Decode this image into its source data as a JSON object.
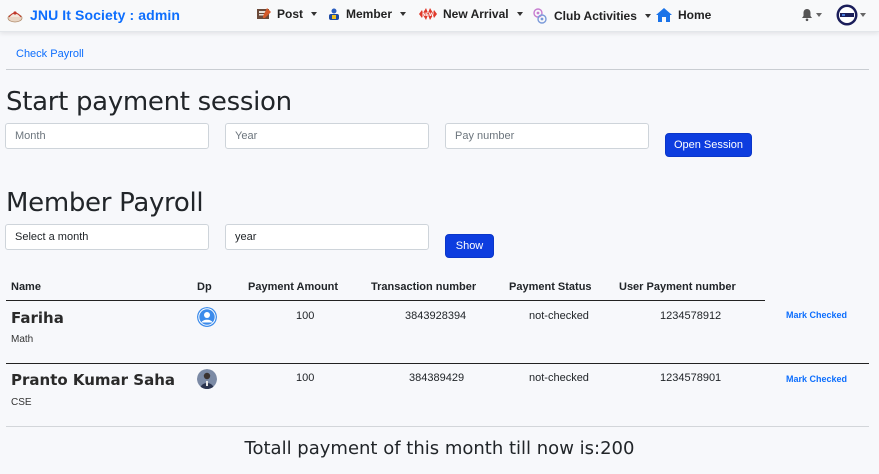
{
  "app": {
    "brand": "JNU It Society : admin"
  },
  "nav": {
    "post": "Post",
    "member": "Member",
    "new_arrival": "New Arrival",
    "club_activities": "Club Activities",
    "home": "Home"
  },
  "breadcrumb": "Check Payroll",
  "session": {
    "title": "Start payment session",
    "month_placeholder": "Month",
    "year_placeholder": "Year",
    "pay_number_placeholder": "Pay number",
    "open_button": "Open Session"
  },
  "payroll": {
    "title": "Member Payroll",
    "month_select": "Select a month",
    "year_value": "year",
    "show_button": "Show"
  },
  "table": {
    "headers": [
      "Name",
      "Dp",
      "Payment Amount",
      "Transaction number",
      "Payment Status",
      "User Payment number"
    ],
    "rows": [
      {
        "name": "Fariha",
        "dept": "Math",
        "amount": "100",
        "transaction": "3843928394",
        "status": "not-checked",
        "user_number": "1234578912",
        "action": "Mark Checked"
      },
      {
        "name": "Pranto Kumar Saha",
        "dept": "CSE",
        "amount": "100",
        "transaction": "384389429",
        "status": "not-checked",
        "user_number": "1234578901",
        "action": "Mark Checked"
      }
    ]
  },
  "total": "Totall payment of this month till now is:200",
  "colors": {
    "primary": "#0d6efd",
    "button": "#0d3ddf"
  }
}
